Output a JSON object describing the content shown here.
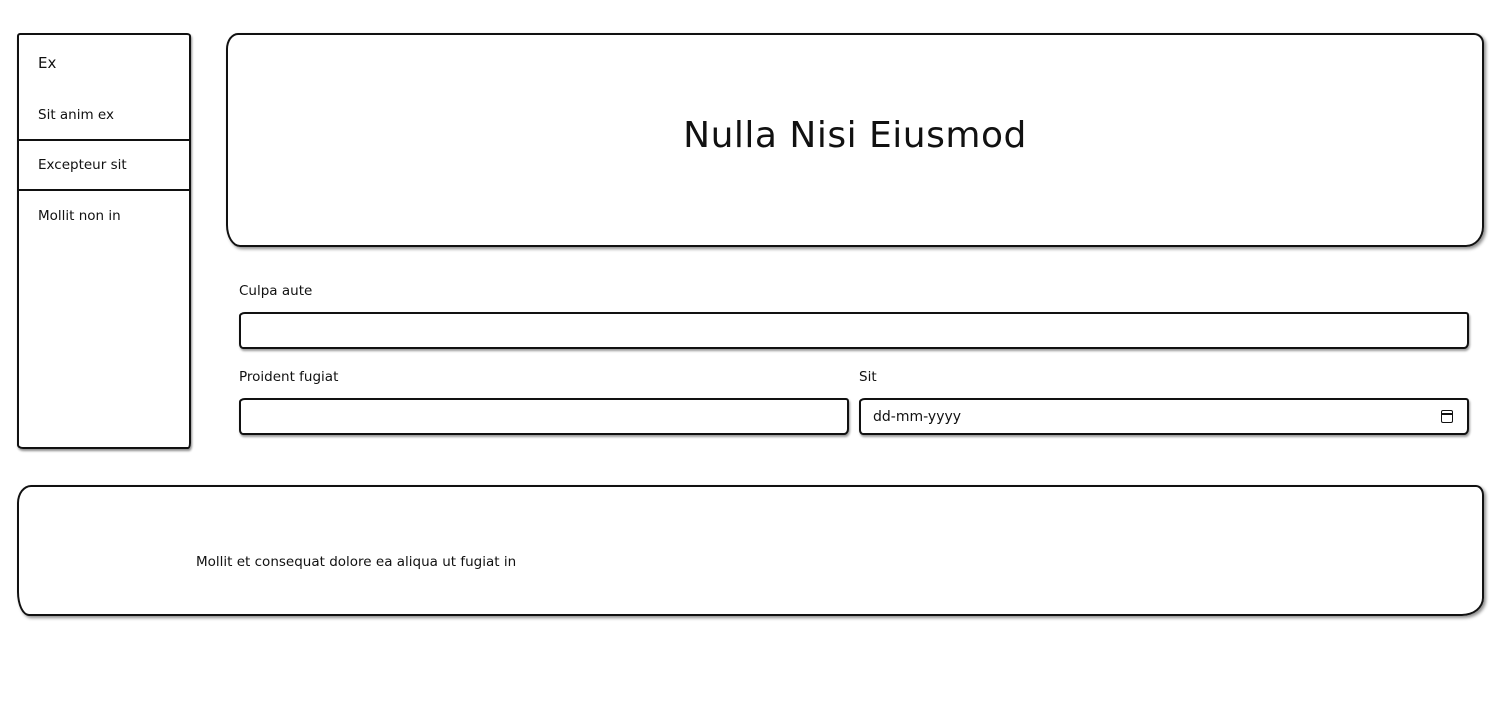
{
  "sidebar": {
    "title": "Ex",
    "items": [
      {
        "label": "Sit anim ex"
      },
      {
        "label": "Excepteur sit"
      },
      {
        "label": "Mollit non in"
      }
    ]
  },
  "hero": {
    "title": "Nulla Nisi Eiusmod"
  },
  "form": {
    "field1": {
      "label": "Culpa aute",
      "value": ""
    },
    "field2": {
      "label": "Proident fugiat",
      "value": ""
    },
    "field3": {
      "label": "Sit",
      "placeholder": "dd-mm-yyyy"
    }
  },
  "footer": {
    "text": "Mollit et consequat dolore ea aliqua ut fugiat in"
  },
  "icons": {
    "date_field": "calendar-icon"
  }
}
